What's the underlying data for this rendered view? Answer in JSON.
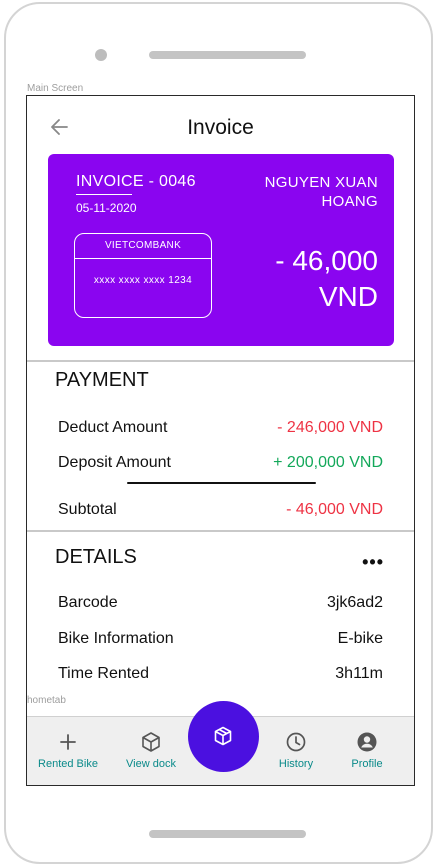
{
  "frame_labels": {
    "main": "Main Screen",
    "tab": "hometab"
  },
  "header": {
    "title": "Invoice"
  },
  "invoice_card": {
    "invoice_number": "INVOICE - 0046",
    "date": "05-11-2020",
    "customer_name": "NGUYEN XUAN HOANG",
    "bank_name": "VIETCOMBANK",
    "card_number": "xxxx xxxx xxxx 1234",
    "amount": "- 46,000",
    "currency": "VND",
    "background_color": "#8a05f0"
  },
  "payment": {
    "title": "PAYMENT",
    "rows": [
      {
        "label": "Deduct Amount",
        "value": "- 246,000 VND",
        "color": "#ee3344"
      },
      {
        "label": "Deposit Amount",
        "value": "+ 200,000 VND",
        "color": "#13a85a"
      }
    ],
    "subtotal": {
      "label": "Subtotal",
      "value": "- 46,000 VND",
      "color": "#ee3344"
    }
  },
  "details": {
    "title": "DETAILS",
    "more_label": "•••",
    "rows": [
      {
        "label": "Barcode",
        "value": "3jk6ad2"
      },
      {
        "label": "Bike Information",
        "value": "E-bike"
      },
      {
        "label": "Time Rented",
        "value": "3h11m"
      }
    ]
  },
  "tabbar": {
    "tabs": [
      {
        "label": "Rented Bike",
        "icon": "plus-icon"
      },
      {
        "label": "View dock",
        "icon": "cube-icon"
      },
      {
        "label": "History",
        "icon": "clock-icon"
      },
      {
        "label": "Profile",
        "icon": "user-circle-icon"
      }
    ],
    "fab_icon": "box-icon",
    "fab_color": "#4b10e0",
    "accent_color": "#0a8a8a"
  }
}
